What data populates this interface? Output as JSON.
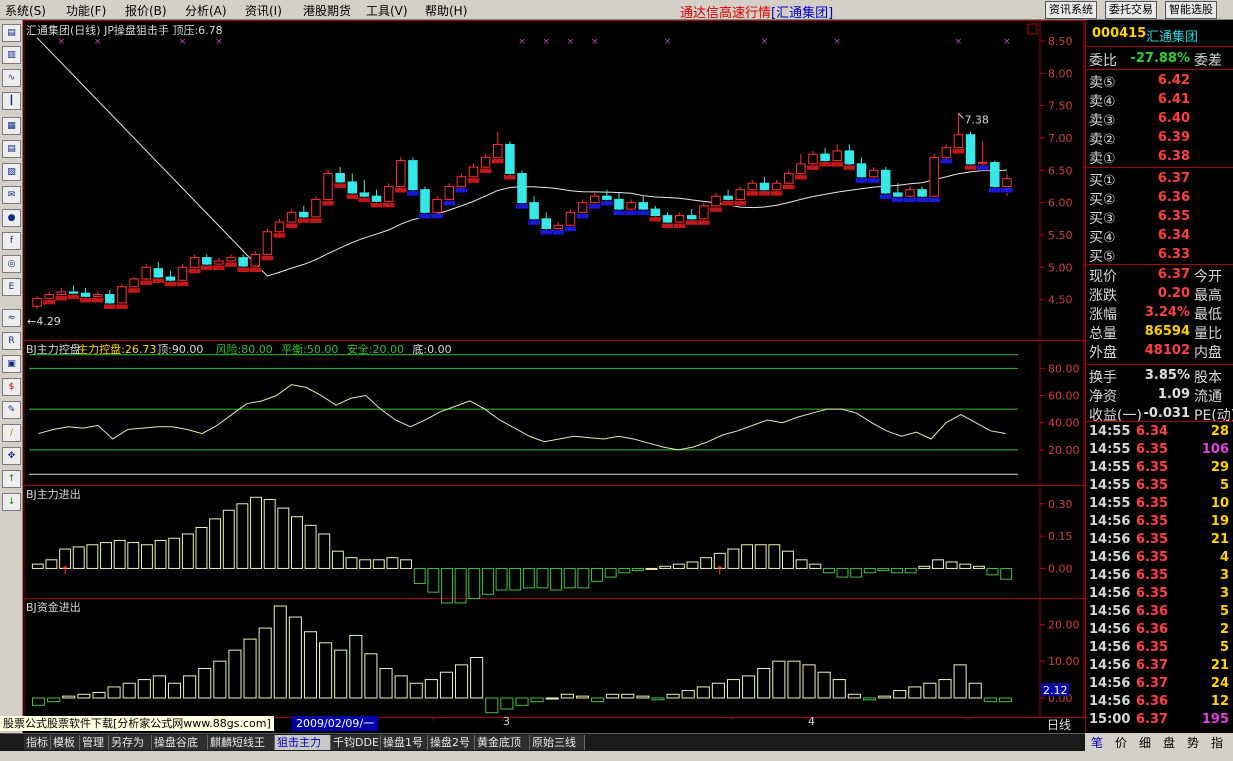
{
  "menu": {
    "items": [
      "系统(S)",
      "功能(F)",
      "报价(B)",
      "分析(A)",
      "资讯(I)",
      "港股期货",
      "工具(V)",
      "帮助(H)"
    ],
    "app_title": "通达信高速行情",
    "broker": "[汇通集团]",
    "buttons": [
      "资讯系统",
      "委托交易",
      "智能选股"
    ]
  },
  "toolbar_icons": [
    "quote-list-icon",
    "info-icon",
    "line-chart-icon",
    "kline-icon",
    "grid-icon",
    "board-icon",
    "report-icon",
    "mail-icon",
    "users-icon",
    "function-icon",
    "bell-icon",
    "etf-icon",
    "wave-icon",
    "rsi-icon",
    "calc-icon",
    "dollar-icon",
    "tools-icon",
    "pen-icon",
    "move-icon",
    "arrow-up-icon",
    "arrow-down-icon"
  ],
  "main_chart": {
    "header": "汇通集团(日线) JP操盘狙击手  顶压:6.78",
    "y_ticks": [
      "8.50",
      "8.00",
      "7.50",
      "7.00",
      "6.50",
      "6.00",
      "5.50",
      "5.00",
      "4.50"
    ],
    "high_label": "7.38",
    "low_label": "4.29",
    "close_label": "6.37"
  },
  "indicators": [
    {
      "id": "bj-control",
      "header": "BJ主力控盘",
      "parts": [
        "主力控盘:26.73",
        "顶:90.00",
        "风险:80.00",
        "平衡:50.00",
        "安全:20.00",
        "底:0.00"
      ],
      "y_ticks": [
        "80.00",
        "60.00",
        "40.00",
        "20.00"
      ]
    },
    {
      "id": "bj-flow",
      "header": "BJ主力进出",
      "y_ticks": [
        "0.30",
        "0.15",
        "0.00"
      ]
    },
    {
      "id": "bj-money",
      "header": "BJ资金进出",
      "y_ticks": [
        "20.00",
        "10.00",
        "0.00"
      ],
      "current": "2.12"
    }
  ],
  "x_axis": {
    "date": "2009/02/09/一",
    "month_labels": [
      "3",
      "4"
    ],
    "period": "日线"
  },
  "ad_text": "股票公式股票软件下载[分析家公式网www.88gs.com]",
  "bottom_tabs": [
    "指标",
    "模板",
    "管理",
    "另存为",
    "操盘谷底",
    "麒麟短线王",
    "狙击主力",
    "千钧DDE",
    "操盘1号",
    "操盘2号",
    "黄金底顶",
    "原始三线"
  ],
  "active_tab": "狙击主力",
  "stock": {
    "code": "000415",
    "name": "汇通集团",
    "weibi_label": "委比",
    "weibi": "-27.88%",
    "weicha_label": "委差",
    "sells": [
      {
        "l": "卖⑤",
        "p": "6.42"
      },
      {
        "l": "卖④",
        "p": "6.41"
      },
      {
        "l": "卖③",
        "p": "6.40"
      },
      {
        "l": "卖②",
        "p": "6.39"
      },
      {
        "l": "卖①",
        "p": "6.38"
      }
    ],
    "buys": [
      {
        "l": "买①",
        "p": "6.37"
      },
      {
        "l": "买②",
        "p": "6.36"
      },
      {
        "l": "买③",
        "p": "6.35"
      },
      {
        "l": "买④",
        "p": "6.34"
      },
      {
        "l": "买⑤",
        "p": "6.33"
      }
    ],
    "stats": [
      {
        "l": "现价",
        "v": "6.37",
        "c": "#ff4040",
        "l2": "今开"
      },
      {
        "l": "涨跌",
        "v": "0.20",
        "c": "#ff4040",
        "l2": "最高"
      },
      {
        "l": "涨幅",
        "v": "3.24%",
        "c": "#ff4040",
        "l2": "最低"
      },
      {
        "l": "总量",
        "v": "86594",
        "c": "#ffd200",
        "l2": "量比"
      },
      {
        "l": "外盘",
        "v": "48102",
        "c": "#ff4040",
        "l2": "内盘"
      },
      {
        "l": "换手",
        "v": "3.85%",
        "c": "#e0e0e0",
        "l2": "股本"
      },
      {
        "l": "净资",
        "v": "1.09",
        "c": "#e0e0e0",
        "l2": "流通"
      },
      {
        "l": "收益(一)",
        "v": "-0.031",
        "c": "#e0e0e0",
        "l2": "PE(动)"
      }
    ],
    "ticks": [
      {
        "t": "14:55",
        "p": "6.34",
        "v": "28",
        "vc": "#ffd200"
      },
      {
        "t": "14:55",
        "p": "6.35",
        "v": "106",
        "vc": "#e040e0"
      },
      {
        "t": "14:55",
        "p": "6.35",
        "v": "29",
        "vc": "#ffd200"
      },
      {
        "t": "14:55",
        "p": "6.35",
        "v": "5",
        "vc": "#ffd200"
      },
      {
        "t": "14:55",
        "p": "6.35",
        "v": "10",
        "vc": "#ffd200"
      },
      {
        "t": "14:56",
        "p": "6.35",
        "v": "19",
        "vc": "#ffd200"
      },
      {
        "t": "14:56",
        "p": "6.35",
        "v": "21",
        "vc": "#ffd200"
      },
      {
        "t": "14:56",
        "p": "6.35",
        "v": "4",
        "vc": "#ffd200"
      },
      {
        "t": "14:56",
        "p": "6.35",
        "v": "3",
        "vc": "#ffd200"
      },
      {
        "t": "14:56",
        "p": "6.35",
        "v": "3",
        "vc": "#ffd200"
      },
      {
        "t": "14:56",
        "p": "6.36",
        "v": "5",
        "vc": "#ffd200"
      },
      {
        "t": "14:56",
        "p": "6.36",
        "v": "2",
        "vc": "#ffd200"
      },
      {
        "t": "14:56",
        "p": "6.35",
        "v": "5",
        "vc": "#ffd200"
      },
      {
        "t": "14:56",
        "p": "6.37",
        "v": "21",
        "vc": "#ffd200"
      },
      {
        "t": "14:56",
        "p": "6.37",
        "v": "24",
        "vc": "#ffd200"
      },
      {
        "t": "14:56",
        "p": "6.36",
        "v": "12",
        "vc": "#ffd200"
      },
      {
        "t": "15:00",
        "p": "6.37",
        "v": "195",
        "vc": "#e040e0"
      }
    ],
    "tabs": [
      "笔",
      "价",
      "细",
      "盘",
      "势",
      "指"
    ]
  },
  "chart_data": [
    {
      "type": "candlestick",
      "title": "汇通集团(日线) JP操盘狙击手  顶压:6.78",
      "ylim": [
        4.0,
        8.7
      ],
      "bars": [
        [
          4.4,
          4.55,
          4.35,
          4.52
        ],
        [
          4.52,
          4.62,
          4.45,
          4.58
        ],
        [
          4.58,
          4.68,
          4.52,
          4.62
        ],
        [
          4.62,
          4.72,
          4.55,
          4.6
        ],
        [
          4.6,
          4.68,
          4.5,
          4.55
        ],
        [
          4.55,
          4.62,
          4.45,
          4.58
        ],
        [
          4.58,
          4.65,
          4.4,
          4.45
        ],
        [
          4.45,
          4.75,
          4.4,
          4.7
        ],
        [
          4.7,
          4.85,
          4.62,
          4.82
        ],
        [
          4.82,
          5.05,
          4.78,
          5.0
        ],
        [
          4.98,
          5.08,
          4.8,
          4.85
        ],
        [
          4.85,
          4.95,
          4.75,
          4.8
        ],
        [
          4.8,
          5.05,
          4.78,
          5.0
        ],
        [
          5.0,
          5.2,
          4.95,
          5.15
        ],
        [
          5.15,
          5.2,
          5.0,
          5.05
        ],
        [
          5.05,
          5.15,
          4.95,
          5.1
        ],
        [
          5.1,
          5.2,
          5.05,
          5.15
        ],
        [
          5.15,
          5.2,
          4.98,
          5.02
        ],
        [
          5.02,
          5.25,
          5.0,
          5.2
        ],
        [
          5.2,
          5.6,
          5.18,
          5.55
        ],
        [
          5.55,
          5.75,
          5.45,
          5.7
        ],
        [
          5.7,
          5.9,
          5.65,
          5.85
        ],
        [
          5.85,
          5.95,
          5.72,
          5.78
        ],
        [
          5.78,
          6.1,
          5.75,
          6.05
        ],
        [
          6.05,
          6.5,
          6.0,
          6.45
        ],
        [
          6.45,
          6.55,
          6.28,
          6.32
        ],
        [
          6.32,
          6.45,
          6.1,
          6.15
        ],
        [
          6.15,
          6.35,
          6.05,
          6.1
        ],
        [
          6.1,
          6.2,
          5.98,
          6.02
        ],
        [
          6.02,
          6.3,
          5.98,
          6.25
        ],
        [
          6.25,
          6.7,
          6.2,
          6.65
        ],
        [
          6.65,
          6.7,
          6.15,
          6.2
        ],
        [
          6.2,
          6.25,
          5.8,
          5.85
        ],
        [
          5.85,
          6.1,
          5.8,
          6.05
        ],
        [
          6.05,
          6.3,
          6.0,
          6.25
        ],
        [
          6.25,
          6.45,
          6.2,
          6.4
        ],
        [
          6.4,
          6.6,
          6.35,
          6.55
        ],
        [
          6.55,
          6.75,
          6.45,
          6.7
        ],
        [
          6.7,
          7.1,
          6.6,
          6.9
        ],
        [
          6.9,
          6.95,
          6.4,
          6.45
        ],
        [
          6.45,
          6.5,
          5.95,
          6.0
        ],
        [
          6.0,
          6.1,
          5.65,
          5.75
        ],
        [
          5.75,
          5.85,
          5.5,
          5.6
        ],
        [
          5.6,
          5.7,
          5.55,
          5.65
        ],
        [
          5.65,
          5.9,
          5.6,
          5.85
        ],
        [
          5.85,
          6.05,
          5.8,
          6.0
        ],
        [
          6.0,
          6.15,
          5.9,
          6.1
        ],
        [
          6.1,
          6.2,
          5.95,
          6.05
        ],
        [
          6.05,
          6.15,
          5.85,
          5.9
        ],
        [
          5.9,
          6.05,
          5.8,
          6.0
        ],
        [
          6.0,
          6.1,
          5.85,
          5.9
        ],
        [
          5.9,
          5.95,
          5.7,
          5.8
        ],
        [
          5.8,
          5.85,
          5.65,
          5.7
        ],
        [
          5.7,
          5.85,
          5.6,
          5.8
        ],
        [
          5.8,
          5.9,
          5.7,
          5.75
        ],
        [
          5.75,
          6.0,
          5.72,
          5.95
        ],
        [
          5.95,
          6.15,
          5.9,
          6.1
        ],
        [
          6.1,
          6.2,
          6.0,
          6.05
        ],
        [
          6.05,
          6.25,
          6.0,
          6.2
        ],
        [
          6.2,
          6.35,
          6.15,
          6.3
        ],
        [
          6.3,
          6.4,
          6.15,
          6.2
        ],
        [
          6.2,
          6.35,
          6.1,
          6.3
        ],
        [
          6.3,
          6.5,
          6.25,
          6.45
        ],
        [
          6.45,
          6.75,
          6.4,
          6.6
        ],
        [
          6.6,
          6.8,
          6.5,
          6.75
        ],
        [
          6.75,
          6.85,
          6.55,
          6.65
        ],
        [
          6.65,
          6.9,
          6.6,
          6.8
        ],
        [
          6.8,
          6.9,
          6.55,
          6.6
        ],
        [
          6.6,
          6.7,
          6.3,
          6.4
        ],
        [
          6.4,
          6.55,
          6.35,
          6.5
        ],
        [
          6.5,
          6.55,
          6.1,
          6.15
        ],
        [
          6.15,
          6.3,
          6.0,
          6.1
        ],
        [
          6.1,
          6.25,
          6.05,
          6.2
        ],
        [
          6.2,
          6.25,
          6.05,
          6.1
        ],
        [
          6.1,
          6.75,
          6.05,
          6.7
        ],
        [
          6.7,
          6.9,
          6.6,
          6.85
        ],
        [
          6.85,
          7.38,
          6.8,
          7.05
        ],
        [
          7.05,
          7.1,
          6.5,
          6.6
        ],
        [
          6.6,
          6.95,
          6.55,
          6.62
        ],
        [
          6.62,
          6.65,
          6.15,
          6.25
        ],
        [
          6.25,
          6.45,
          6.1,
          6.37
        ]
      ],
      "high": 7.38,
      "low": 4.29
    },
    {
      "type": "line",
      "title": "BJ主力控盘",
      "ylim": [
        0,
        95
      ],
      "reference_lines": [
        90,
        80,
        50,
        20,
        0
      ],
      "values": [
        32,
        35,
        37,
        36,
        38,
        28,
        35,
        36,
        37,
        37,
        35,
        32,
        38,
        46,
        54,
        56,
        60,
        68,
        66,
        60,
        53,
        58,
        60,
        50,
        42,
        37,
        42,
        48,
        52,
        56,
        50,
        42,
        36,
        30,
        26,
        28,
        30,
        29,
        28,
        30,
        28,
        25,
        22,
        20,
        22,
        26,
        31,
        34,
        38,
        42,
        40,
        44,
        47,
        50,
        50,
        47,
        40,
        34,
        30,
        33,
        28,
        40,
        46,
        40,
        34,
        32
      ]
    },
    {
      "type": "bar",
      "title": "BJ主力进出",
      "ylim": [
        -0.1,
        0.35
      ],
      "values": [
        0.02,
        0.04,
        0.09,
        0.1,
        0.11,
        0.12,
        0.13,
        0.12,
        0.11,
        0.13,
        0.14,
        0.16,
        0.19,
        0.23,
        0.27,
        0.3,
        0.33,
        0.32,
        0.28,
        0.24,
        0.2,
        0.16,
        0.08,
        0.05,
        0.04,
        0.04,
        0.05,
        0.04,
        -0.07,
        -0.11,
        -0.16,
        -0.16,
        -0.14,
        -0.12,
        -0.1,
        -0.1,
        -0.09,
        -0.09,
        -0.1,
        -0.09,
        -0.09,
        -0.06,
        -0.04,
        -0.02,
        -0.01,
        0.0,
        0.01,
        0.02,
        0.03,
        0.05,
        0.07,
        0.09,
        0.11,
        0.11,
        0.11,
        0.08,
        0.04,
        0.02,
        -0.02,
        -0.04,
        -0.04,
        -0.02,
        -0.01,
        -0.02,
        -0.02,
        0.01,
        0.04,
        0.03,
        0.02,
        0.01,
        -0.03,
        -0.05
      ],
      "markers_up_at": [
        2,
        50
      ]
    },
    {
      "type": "bar",
      "title": "BJ资金进出",
      "ylim": [
        -3,
        25
      ],
      "values": [
        -2,
        -1,
        0.5,
        1,
        1.5,
        3,
        4,
        5,
        6,
        4,
        6,
        8,
        10,
        13,
        16,
        19,
        25,
        22,
        18,
        15,
        13,
        17,
        12,
        8,
        6,
        4,
        5,
        7,
        9,
        11,
        -4,
        -3,
        -2,
        -1,
        0,
        1,
        0.5,
        -1,
        1,
        1,
        0.5,
        -0.5,
        1,
        2,
        3,
        4,
        5,
        6,
        8,
        10,
        10,
        9,
        7,
        5,
        1,
        -0.5,
        0.5,
        2,
        3,
        4,
        5,
        9,
        4,
        -1,
        -1
      ]
    }
  ]
}
